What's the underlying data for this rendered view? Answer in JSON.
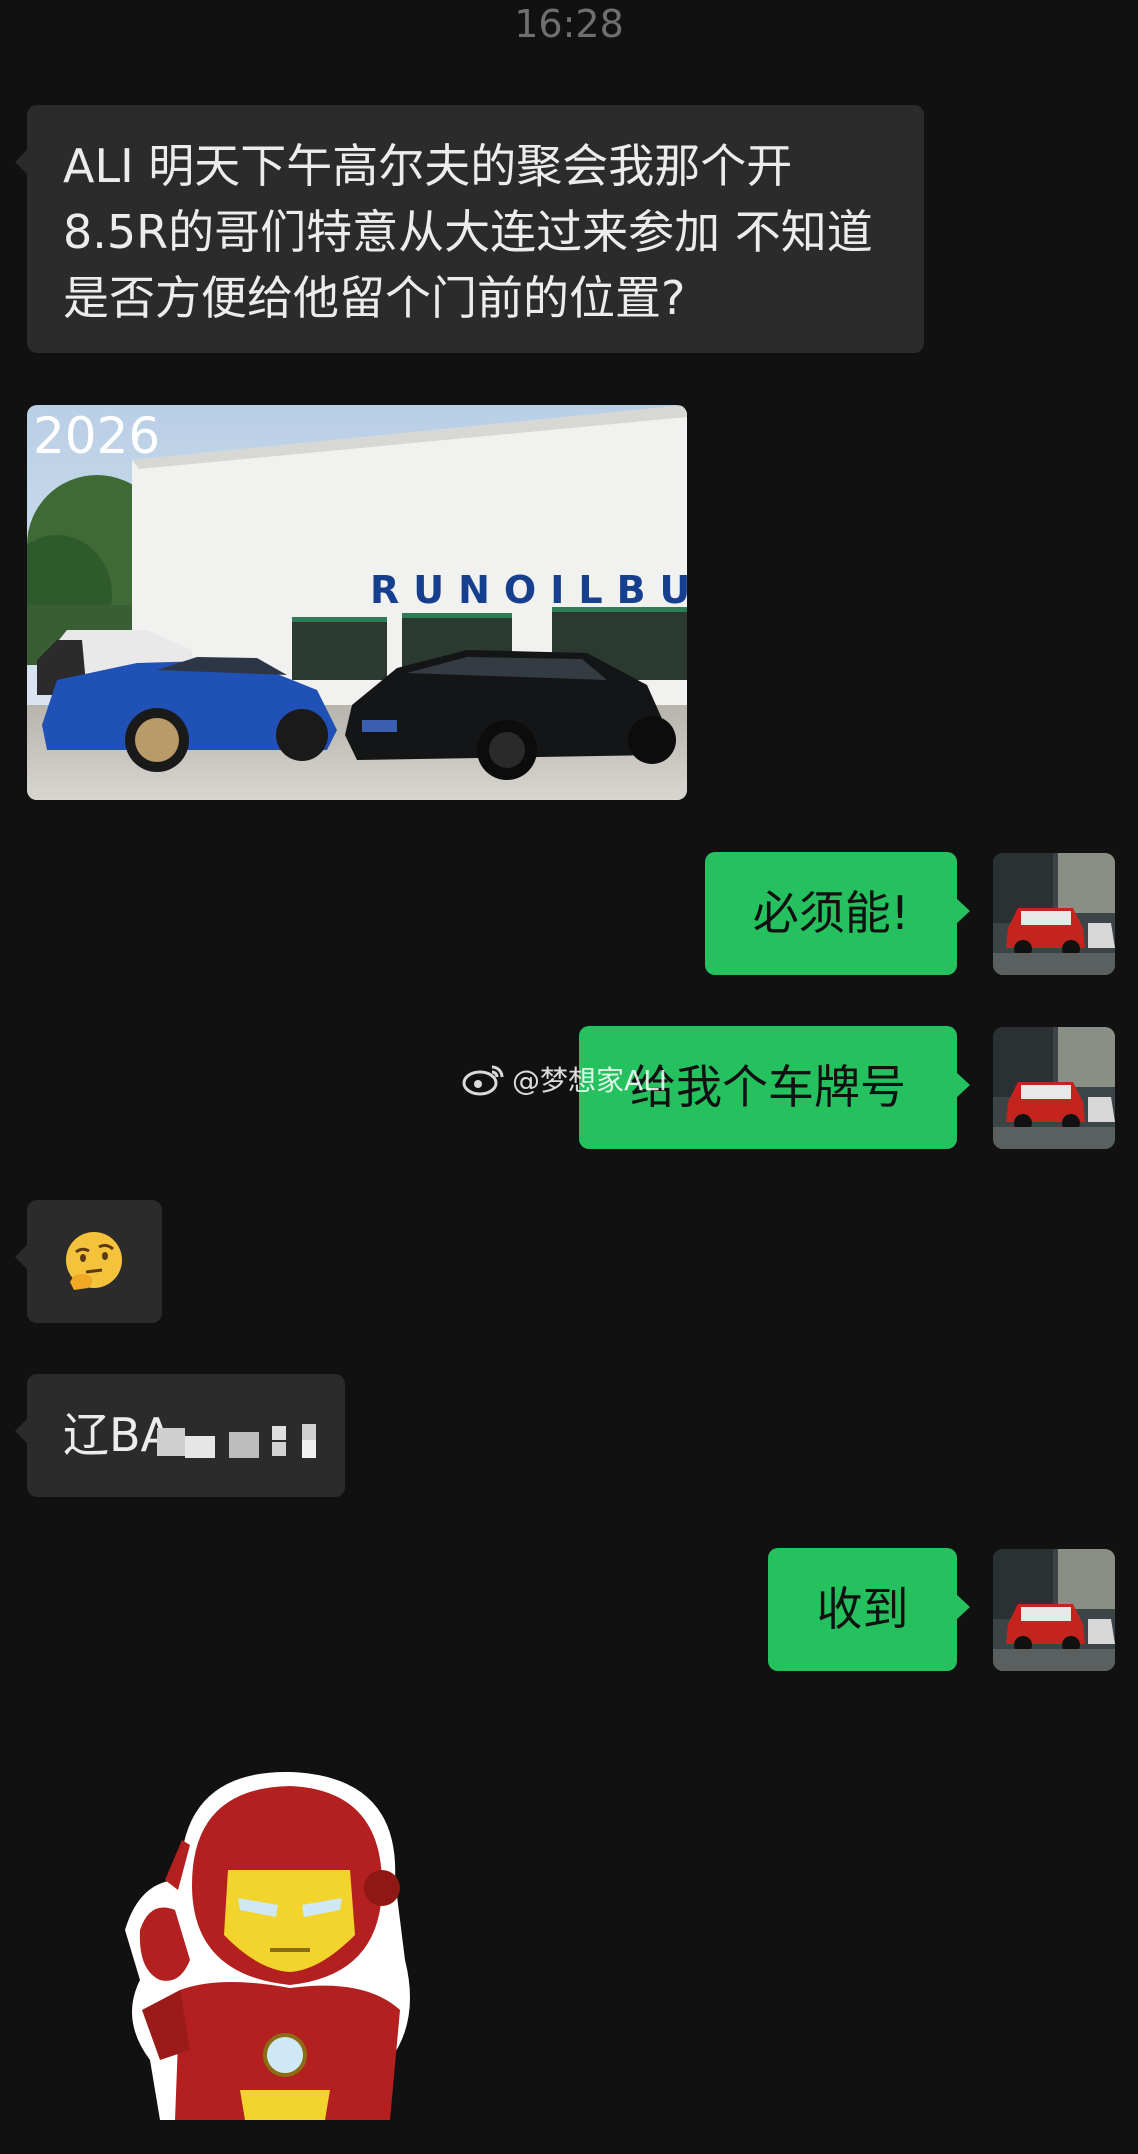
{
  "status": {
    "time": "16:28"
  },
  "messages": [
    {
      "side": "in",
      "type": "text",
      "text": "ALI 明天下午高尔夫的聚会我那个开8.5R的哥们特意从大连过来参加  不知道是否方便给他留个门前的位置?"
    },
    {
      "side": "in",
      "type": "image",
      "caption": "2026",
      "sign_text": "RUNOILBU"
    },
    {
      "side": "out",
      "type": "text",
      "text": "必须能!"
    },
    {
      "side": "out",
      "type": "text",
      "text": "给我个车牌号"
    },
    {
      "side": "in",
      "type": "emoji",
      "icon": "thinking-face-icon"
    },
    {
      "side": "in",
      "type": "text",
      "text": "辽BA"
    },
    {
      "side": "out",
      "type": "text",
      "text": "收到"
    },
    {
      "side": "in",
      "type": "sticker",
      "icon": "iron-man-sticker"
    }
  ],
  "watermark": {
    "text": "@梦想家ALI",
    "icon": "weibo-logo-icon"
  },
  "colors": {
    "background": "#111111",
    "incoming_bubble": "#2b2b2b",
    "outgoing_bubble": "#25c15f",
    "timestamp": "#6f6f6f"
  }
}
